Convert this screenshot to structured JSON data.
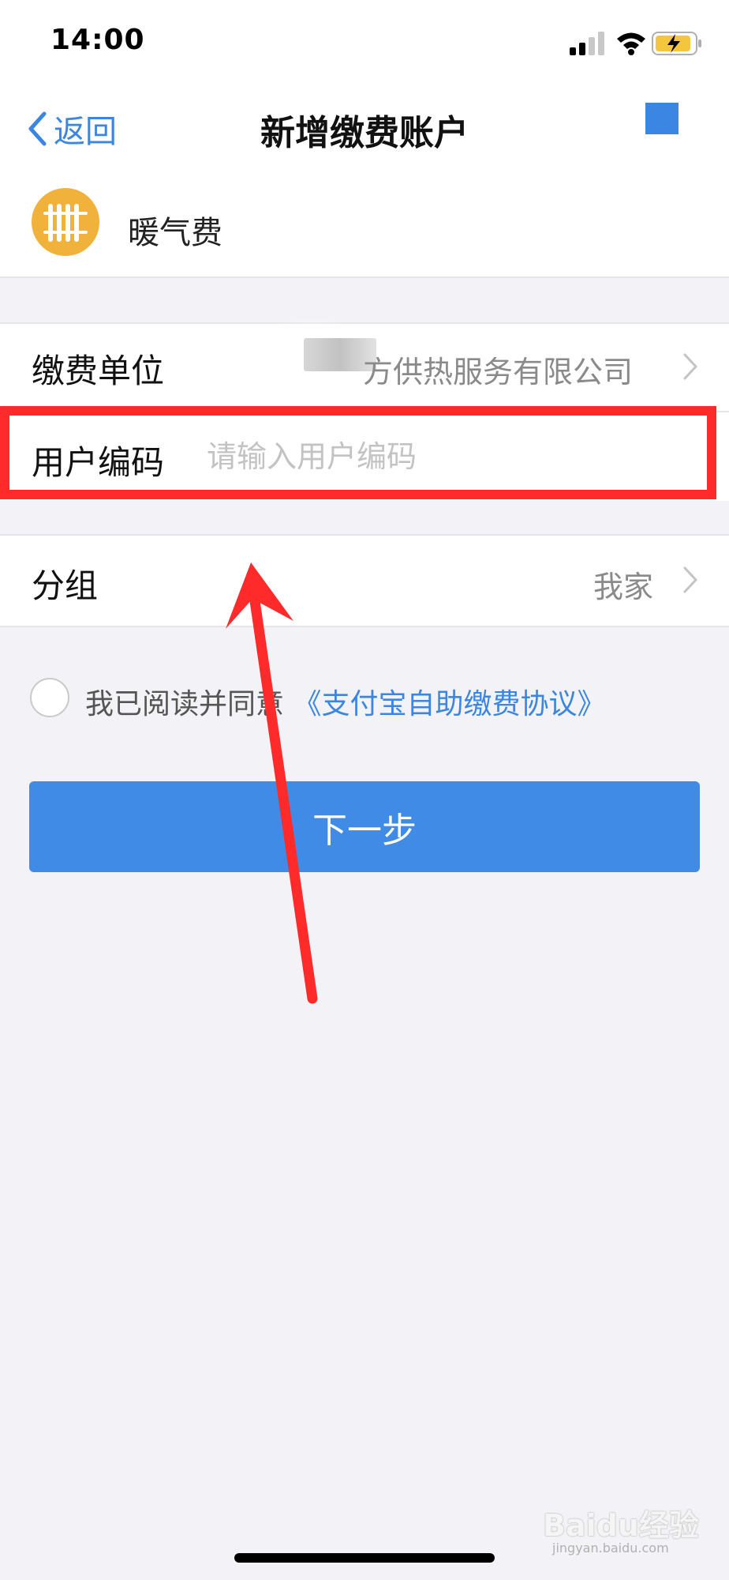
{
  "status_bar": {
    "time": "14:00"
  },
  "nav": {
    "back_label": "返回",
    "title": "新增缴费账户"
  },
  "service": {
    "name": "暖气费",
    "icon": "radiator-icon",
    "icon_color": "#f1b23c"
  },
  "form": {
    "unit": {
      "label": "缴费单位",
      "value": "方供热服务有限公司"
    },
    "user_code": {
      "label": "用户编码",
      "placeholder": "请输入用户编码",
      "value": ""
    },
    "group": {
      "label": "分组",
      "value": "我家"
    }
  },
  "agreement": {
    "prefix": "我已阅读并同意",
    "link": "《支付宝自助缴费协议》",
    "checked": false
  },
  "button": {
    "label": "下一步"
  },
  "annotation": {
    "color": "#ff2b2b"
  },
  "watermark": {
    "text": "Baidu经验",
    "sub": "jingyan.baidu.com"
  },
  "colors": {
    "accent": "#3a86e2",
    "button": "#3f8be6",
    "background": "#f3f3f7"
  }
}
